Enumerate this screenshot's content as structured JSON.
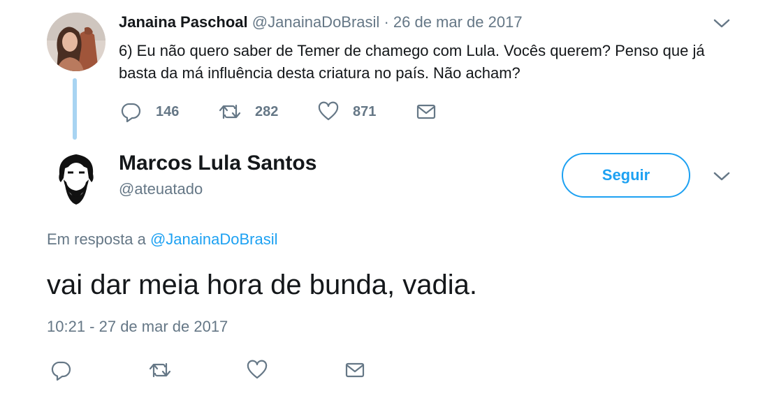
{
  "parent_tweet": {
    "name": "Janaina Paschoal",
    "handle": "@JanainaDoBrasil",
    "separator": "·",
    "date": "26 de mar de 2017",
    "text": "6) Eu não quero saber de Temer de chamego com Lula. Vocês querem? Penso que já basta da má influência desta criatura no país. Não acham?",
    "replies": "146",
    "retweets": "282",
    "likes": "871"
  },
  "reply_tweet": {
    "name": "Marcos Lula Santos",
    "handle": "@ateuatado",
    "follow_label": "Seguir",
    "reply_prefix": "Em resposta a",
    "reply_mention": "@JanainaDoBrasil",
    "text": "vai dar meia hora de bunda, vadia.",
    "timestamp": "10:21 - 27 de mar de 2017"
  },
  "icons": {
    "reply": "reply-icon",
    "retweet": "retweet-icon",
    "like": "heart-icon",
    "dm": "envelope-icon",
    "menu": "chevron-down-icon"
  },
  "colors": {
    "accent": "#1da1f2",
    "text_primary": "#14171a",
    "text_secondary": "#657786",
    "thread_line": "#a8d4f2"
  }
}
